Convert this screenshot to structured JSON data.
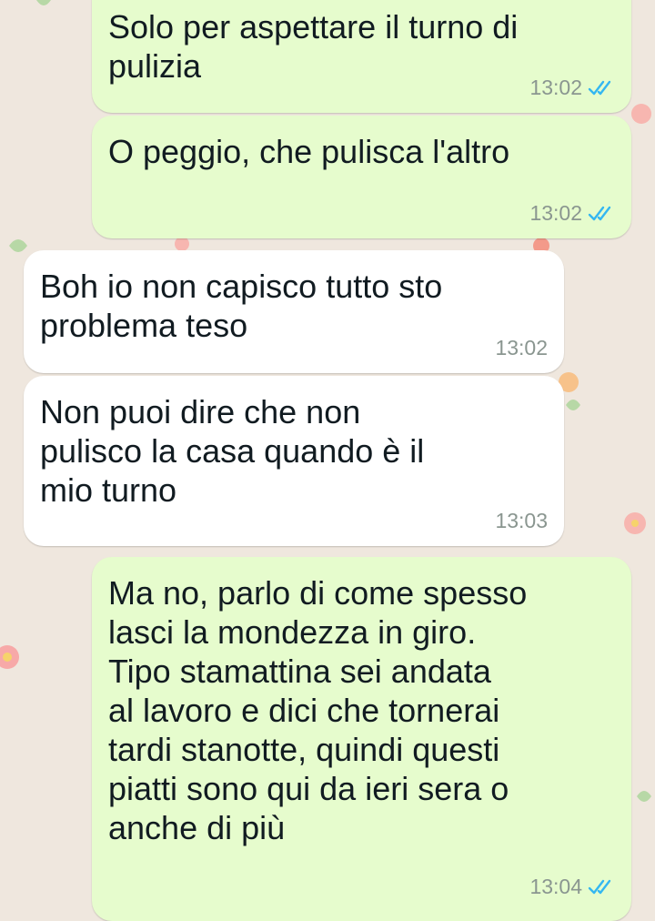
{
  "chat": {
    "accent_colors": {
      "outgoing_bubble": "#e6fccd",
      "incoming_bubble": "#ffffff",
      "read_ticks": "#34b7f1",
      "timestamp": "#8a9690"
    },
    "messages": [
      {
        "direction": "outgoing",
        "text": "Solo per aspettare il turno di\npulizia",
        "time": "13:02",
        "status_icon": "double-check-read-icon"
      },
      {
        "direction": "outgoing",
        "text": "O peggio, che pulisca l'altro",
        "time": "13:02",
        "status_icon": "double-check-read-icon"
      },
      {
        "direction": "incoming",
        "text": "Boh io non capisco tutto sto\nproblema teso",
        "time": "13:02"
      },
      {
        "direction": "incoming",
        "text": "Non puoi dire che non\npulisco la casa quando è il\nmio turno",
        "time": "13:03"
      },
      {
        "direction": "outgoing",
        "text": "Ma no, parlo di come spesso\nlasci la mondezza in giro.\nTipo stamattina sei andata\nal lavoro e dici che tornerai\ntardi stanotte, quindi questi\npiatti sono qui da ieri sera o\nanche di più",
        "time": "13:04",
        "status_icon": "double-check-read-icon"
      }
    ]
  }
}
